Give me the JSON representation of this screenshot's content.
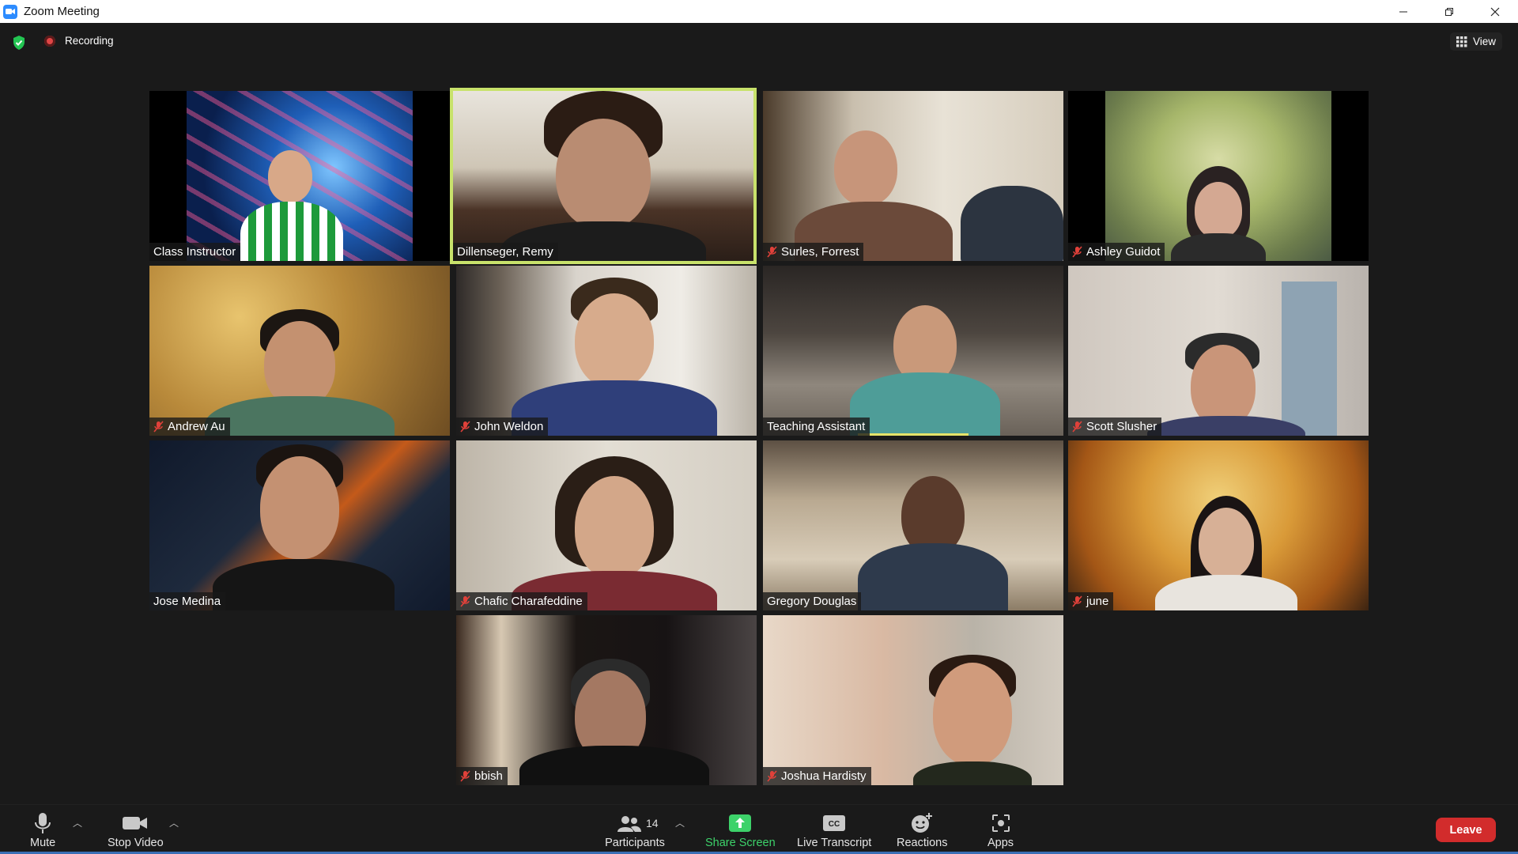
{
  "window": {
    "title": "Zoom Meeting"
  },
  "topbar": {
    "recording_label": "Recording",
    "view_label": "View"
  },
  "participants": [
    {
      "name": "Class Instructor",
      "muted": false
    },
    {
      "name": "Dillenseger, Remy",
      "muted": false,
      "active_speaker": true
    },
    {
      "name": "Surles, Forrest",
      "muted": true
    },
    {
      "name": "Ashley Guidot",
      "muted": true
    },
    {
      "name": "Andrew Au",
      "muted": true
    },
    {
      "name": "John Weldon",
      "muted": true
    },
    {
      "name": "Teaching Assistant",
      "muted": false
    },
    {
      "name": "Scott Slusher",
      "muted": true
    },
    {
      "name": "Jose Medina",
      "muted": false
    },
    {
      "name": "Chafic Charafeddine",
      "muted": true
    },
    {
      "name": "Gregory Douglas",
      "muted": false
    },
    {
      "name": "june",
      "muted": true
    },
    {
      "name": "bbish",
      "muted": true
    },
    {
      "name": "Joshua Hardisty",
      "muted": true
    }
  ],
  "toolbar": {
    "mute_label": "Mute",
    "stop_video_label": "Stop Video",
    "participants_label": "Participants",
    "participants_count": "14",
    "share_screen_label": "Share Screen",
    "live_transcript_label": "Live Transcript",
    "reactions_label": "Reactions",
    "apps_label": "Apps",
    "leave_label": "Leave"
  },
  "colors": {
    "active_speaker_border": "#c8e26b",
    "leave_button": "#d22c2c",
    "share_screen": "#3dd26a",
    "recording_dot": "#e04646"
  }
}
